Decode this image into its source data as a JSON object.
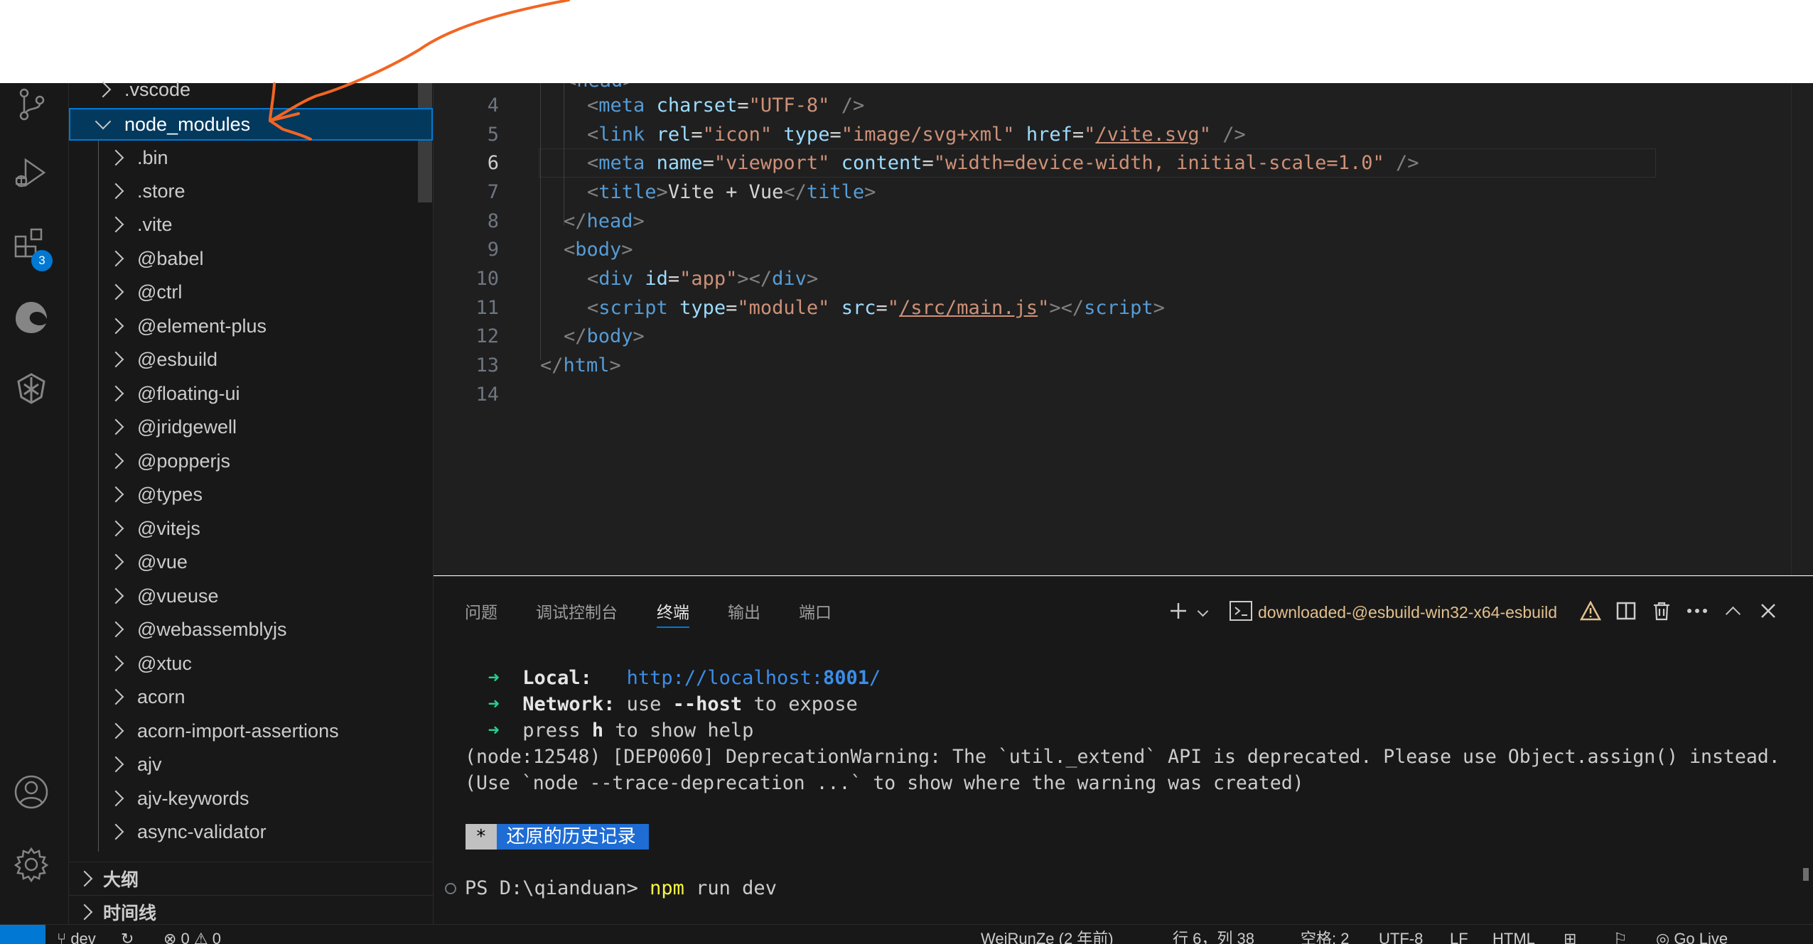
{
  "explorer": {
    "items": [
      {
        "label": ".vscode",
        "expanded": false
      },
      {
        "label": "node_modules",
        "expanded": true,
        "selected": true
      },
      {
        "label": ".bin"
      },
      {
        "label": ".store"
      },
      {
        "label": ".vite"
      },
      {
        "label": "@babel"
      },
      {
        "label": "@ctrl"
      },
      {
        "label": "@element-plus"
      },
      {
        "label": "@esbuild"
      },
      {
        "label": "@floating-ui"
      },
      {
        "label": "@jridgewell"
      },
      {
        "label": "@popperjs"
      },
      {
        "label": "@types"
      },
      {
        "label": "@vitejs"
      },
      {
        "label": "@vue"
      },
      {
        "label": "@vueuse"
      },
      {
        "label": "@webassemblyjs"
      },
      {
        "label": "@xtuc"
      },
      {
        "label": "acorn"
      },
      {
        "label": "acorn-import-assertions"
      },
      {
        "label": "ajv"
      },
      {
        "label": "ajv-keywords"
      },
      {
        "label": "async-validator"
      }
    ],
    "outline_label": "大纲",
    "timeline_label": "时间线"
  },
  "activity": {
    "icons": [
      "source-control-icon",
      "run-debug-icon",
      "extensions-icon",
      "edge-icon",
      "remote-icon",
      "account-icon",
      "settings-gear-icon"
    ],
    "extensions_badge": "3"
  },
  "editor": {
    "line_numbers": [
      "4",
      "5",
      "6",
      "7",
      "8",
      "9",
      "10",
      "11",
      "12",
      "13",
      "14"
    ],
    "active_line": "6"
  },
  "panel": {
    "tabs": [
      "问题",
      "调试控制台",
      "终端",
      "输出",
      "端口"
    ],
    "active_tab": "终端",
    "terminal_name": "downloaded-@esbuild-win32-x64-esbuild",
    "lines": {
      "local_label": "Local:",
      "local_url_prefix": "http://localhost:",
      "local_port": "8001",
      "local_url_suffix": "/",
      "network_label": "Network:",
      "network_use": "use",
      "network_flag": "--host",
      "network_rest": "to expose",
      "help_press": "press",
      "help_key": "h",
      "help_rest": "to show help",
      "warning_1": "(node:12548) [DEP0060] DeprecationWarning: The `util._extend` API is deprecated. Please use Object.assign() instead.",
      "warning_2": "(Use `node --trace-deprecation ...` to show where the warning was created)",
      "restored_star": "*",
      "restored_msg": "还原的历史记录",
      "prompt": "PS D:\\qianduan>",
      "command": "npm",
      "command_args": "run dev"
    }
  },
  "status_bar": {
    "branch": "dev",
    "errors": "0",
    "warnings": "0",
    "blame": "WeiRunZe (2 年前)",
    "position": "行 6，列 38",
    "spaces": "空格: 2",
    "encoding": "UTF-8",
    "eol": "LF",
    "language": "HTML",
    "go_live": "Go Live"
  },
  "colors": {
    "accent": "#0078d4",
    "annotation_stroke": "#f26522"
  }
}
